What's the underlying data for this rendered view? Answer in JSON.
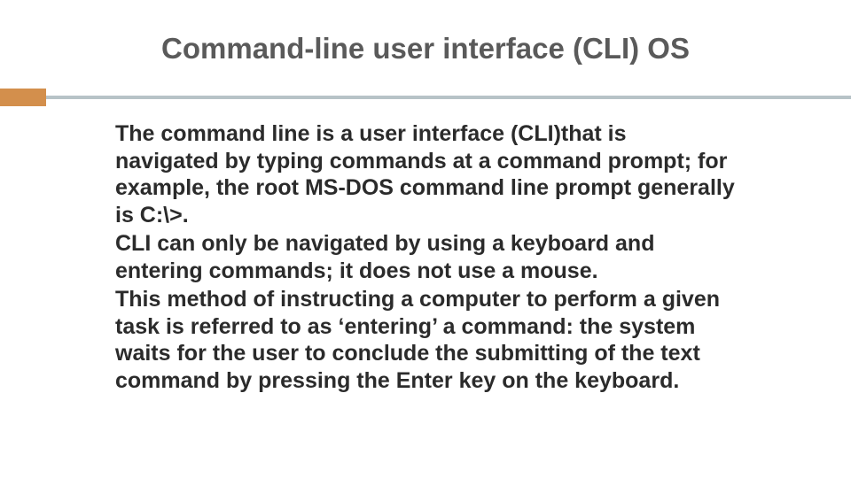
{
  "slide": {
    "title": "Command-line user interface (CLI) OS",
    "paragraphs": [
      "The command line is a user interface (CLI)that is navigated by typing commands at a command prompt; for example, the root MS-DOS command line prompt generally is C:\\>.",
      "CLI can only be navigated by using a keyboard and entering commands; it does not use a mouse.",
      "This method of instructing a computer to perform a given task is referred to as ‘entering’ a command: the system waits for the user to conclude the submitting of the text command by pressing the Enter key on the keyboard."
    ]
  },
  "colors": {
    "accent_orange": "#d38f4c",
    "divider_grey": "#b7c3c7",
    "title_grey": "#5a5a5a"
  }
}
